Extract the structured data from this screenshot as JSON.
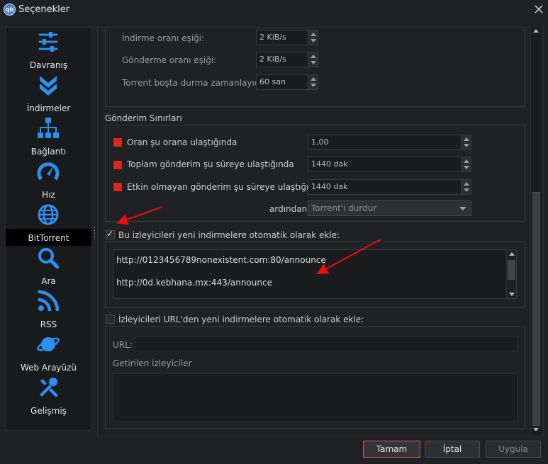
{
  "window": {
    "title": "Seçenekler",
    "app_icon": "qb"
  },
  "sidebar": {
    "items": [
      {
        "label": "Davranış",
        "icon": "sliders-icon"
      },
      {
        "label": "İndirmeler",
        "icon": "double-chevron-down-icon"
      },
      {
        "label": "Bağlantı",
        "icon": "network-icon"
      },
      {
        "label": "Hız",
        "icon": "speedometer-icon"
      },
      {
        "label": "BitTorrent",
        "icon": "globe-icon"
      },
      {
        "label": "Ara",
        "icon": "search-icon"
      },
      {
        "label": "RSS",
        "icon": "rss-icon"
      },
      {
        "label": "Web Arayüzü",
        "icon": "planet-icon"
      },
      {
        "label": "Gelişmiş",
        "icon": "tools-icon"
      }
    ],
    "active_index": 4
  },
  "torrent_queue": {
    "download_threshold_label": "İndirme oranı eşiği:",
    "download_threshold_value": "2 KiB/s",
    "upload_threshold_label": "Gönderme oranı eşiği:",
    "upload_threshold_value": "2 KiB/s",
    "inactivity_timer_label": "Torrent boşta durma zamanlayıcısı:",
    "inactivity_timer_value": "60 san"
  },
  "seeding_limits": {
    "title": "Gönderim Sınırları",
    "ratio_label": "Oran şu orana ulaştığında",
    "ratio_value": "1,00",
    "total_time_label": "Toplam gönderim şu süreye ulaştığında",
    "total_time_value": "1440 dak",
    "inactive_time_label": "Etkin olmayan gönderim şu süreye ulaştığında",
    "inactive_time_value": "1440 dak",
    "then_label": "ardından",
    "then_action": "Torrent'i durdur"
  },
  "auto_trackers": {
    "checkbox_label": "Bu izleyicileri yeni indirmelere otomatik olarak ekle:",
    "checked": true,
    "lines": [
      "http://0123456789nonexistent.com:80/announce",
      "http://0d.kebhana.mx:443/announce"
    ]
  },
  "url_trackers": {
    "checkbox_label": "İzleyicileri URL'den yeni indirmelere otomatik olarak ekle:",
    "checked": false,
    "url_label": "URL:",
    "fetched_label": "Getirilen izleyiciler"
  },
  "footer": {
    "ok_label": "Tamam",
    "cancel_label": "İptal",
    "apply_label": "Uygula"
  },
  "colors": {
    "accent_red": "#d8281e",
    "annotation_arrow": "#e81010"
  }
}
